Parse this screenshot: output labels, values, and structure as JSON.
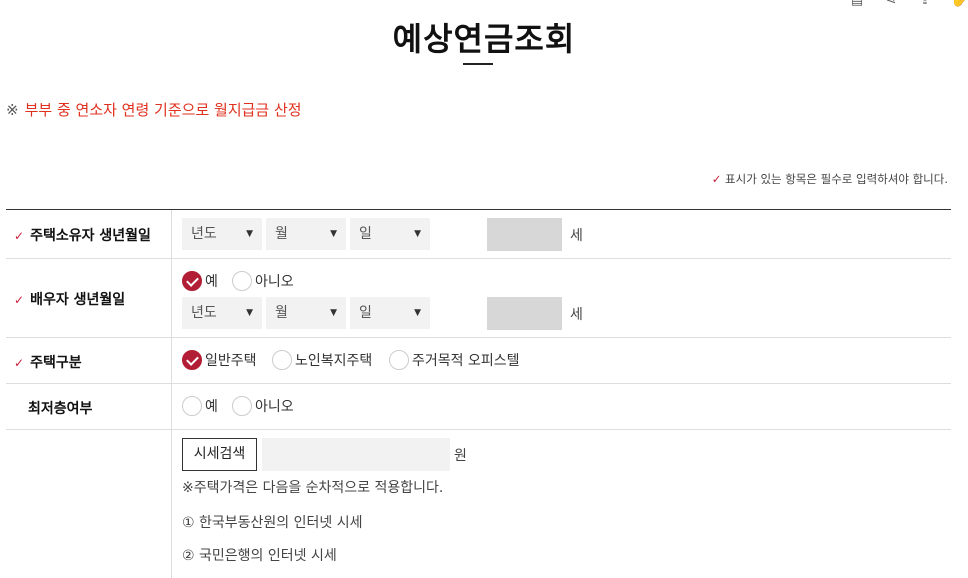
{
  "page_title": "예상연금조회",
  "top_icons": [
    "print-icon",
    "share-icon",
    "export-icon",
    "hand-icon"
  ],
  "notice": {
    "mark": "※",
    "text": "부부 중 연소자 연령 기준으로 월지급금 산정"
  },
  "required_note": "표시가 있는 항목은 필수로 입력하셔야 합니다.",
  "rows": {
    "owner_birth": {
      "label": "주택소유자 생년월일",
      "year": "년도",
      "month": "월",
      "day": "일",
      "age_unit": "세"
    },
    "spouse_birth": {
      "label": "배우자 생년월일",
      "yes": "예",
      "no": "아니오",
      "year": "년도",
      "month": "월",
      "day": "일",
      "age_unit": "세"
    },
    "house_type": {
      "label": "주택구분",
      "opt1": "일반주택",
      "opt2": "노인복지주택",
      "opt3": "주거목적 오피스텔"
    },
    "lowest_floor": {
      "label": "최저층여부",
      "yes": "예",
      "no": "아니오"
    },
    "price": {
      "button": "시세검색",
      "unit": "원",
      "note": "※주택가격은 다음을 순차적으로 적용합니다.",
      "item1": "① 한국부동산원의 인터넷 시세",
      "item2": "② 국민은행의 인터넷 시세"
    }
  },
  "caret": "▼",
  "check": "✓",
  "accent_color": "#b21e35"
}
